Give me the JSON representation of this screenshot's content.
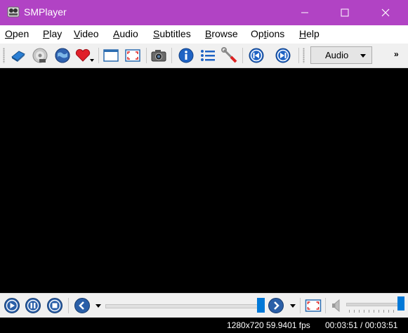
{
  "window": {
    "title": "SMPlayer",
    "controls": [
      "minimize",
      "maximize",
      "close"
    ]
  },
  "menu": {
    "items": [
      {
        "accel": "O",
        "rest": "pen"
      },
      {
        "accel": "P",
        "rest": "lay"
      },
      {
        "accel": "V",
        "rest": "ideo"
      },
      {
        "accel": "A",
        "rest": "udio"
      },
      {
        "accel": "S",
        "rest": "ubtitles"
      },
      {
        "accel": "B",
        "rest": "rowse"
      },
      {
        "accel": "",
        "pre": "Op",
        "accel2": "t",
        "rest": "ions"
      },
      {
        "accel": "H",
        "rest": "elp"
      }
    ]
  },
  "toolbar": {
    "icons": [
      "open-file-icon",
      "open-disc-icon",
      "open-url-icon",
      "favorites-icon",
      "compact-mode-icon",
      "fullscreen-icon",
      "screenshot-icon",
      "info-icon",
      "playlist-icon",
      "preferences-icon",
      "previous-icon",
      "next-icon"
    ],
    "audio_dropdown": "Audio",
    "overflow": "»"
  },
  "controls": {
    "icons": [
      "play-icon",
      "pause-icon",
      "stop-icon",
      "rewind-icon",
      "forward-icon",
      "fullscreen-icon",
      "volume-icon"
    ],
    "seek_position": 0.998,
    "volume_level": 1.0
  },
  "status": {
    "resolution": "1280x720 59.9401 fps",
    "time": "00:03:51 / 00:03:51"
  },
  "colors": {
    "titlebar": "#b143c4",
    "accent": "#0078d7",
    "video_bg": "#000000"
  }
}
